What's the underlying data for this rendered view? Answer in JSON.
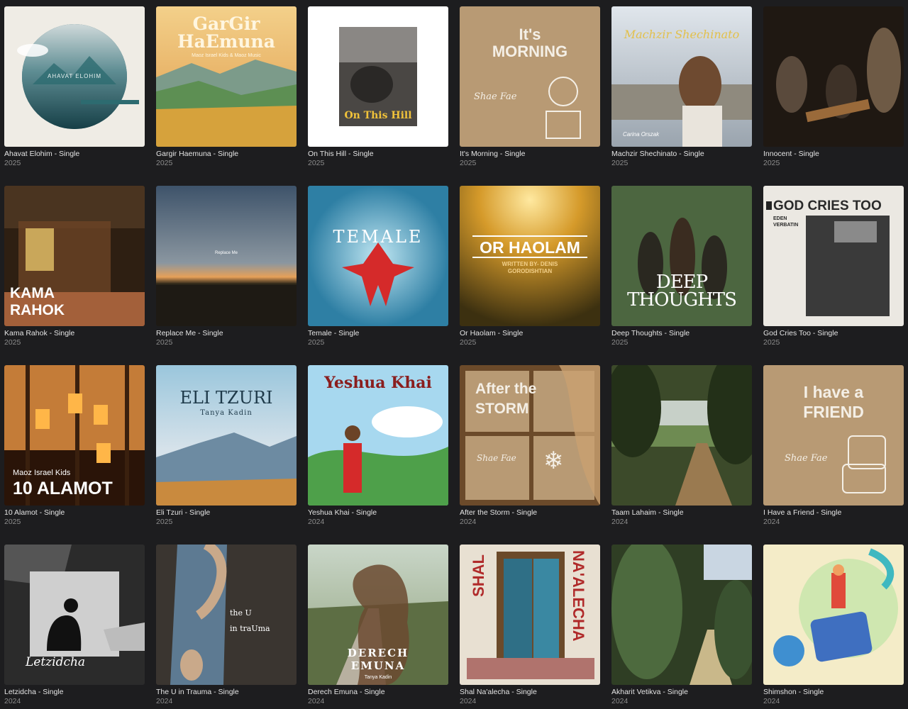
{
  "albums": [
    {
      "title": "Ahavat Elohim - Single",
      "year": "2025",
      "cover_text": "AHAVAT ELOHIM",
      "cover_sub": "",
      "colors": [
        "#f0ede6",
        "#2d6b70"
      ]
    },
    {
      "title": "Gargir Haemuna - Single",
      "year": "2025",
      "cover_text": "GarGir",
      "cover_text2": "HaEmuna",
      "cover_sub": "Maoz Israel Kids & Maoz Music",
      "colors": [
        "#f2c26a",
        "#5d8f53"
      ]
    },
    {
      "title": "On This Hill - Single",
      "year": "2025",
      "cover_text": "On This Hill",
      "cover_sub": "",
      "colors": [
        "#ffffff",
        "#3d3b38"
      ]
    },
    {
      "title": "It's Morning - Single",
      "year": "2025",
      "cover_text": "It's",
      "cover_text2": "MORNING",
      "cover_sub": "Shae Fae",
      "colors": [
        "#b89a74",
        "#f4efe6"
      ]
    },
    {
      "title": "Machzir Shechinato - Single",
      "year": "2025",
      "cover_text": "Machzir Shechinato",
      "cover_sub": "Carina Orszak",
      "colors": [
        "#c9d3de",
        "#e3c04a"
      ]
    },
    {
      "title": "Innocent - Single",
      "year": "2025",
      "cover_text": "",
      "cover_sub": "",
      "colors": [
        "#241d17",
        "#6e5a45"
      ]
    },
    {
      "title": "Kama Rahok - Single",
      "year": "2025",
      "cover_text": "KAMA",
      "cover_text2": "RAHOK",
      "cover_sub": "",
      "colors": [
        "#3b2818",
        "#a3603a"
      ]
    },
    {
      "title": "Replace Me - Single",
      "year": "2025",
      "cover_text": "Replace Me",
      "cover_sub": "",
      "colors": [
        "#45596e",
        "#e6a058"
      ]
    },
    {
      "title": "Temale - Single",
      "year": "2025",
      "cover_text": "TEMALE",
      "cover_sub": "",
      "colors": [
        "#3f8fb0",
        "#d52a2a"
      ]
    },
    {
      "title": "Or Haolam - Single",
      "year": "2025",
      "cover_text": "OR HAOLAM",
      "cover_sub": "WRITTEN BY- DENIS GORODISHTIAN",
      "colors": [
        "#d59a2a",
        "#3c3010"
      ]
    },
    {
      "title": "Deep Thoughts - Single",
      "year": "2025",
      "cover_text": "DEEP",
      "cover_text2": "THOUGHTS",
      "cover_sub": "",
      "colors": [
        "#4c6640",
        "#2a2820"
      ]
    },
    {
      "title": "God Cries Too - Single",
      "year": "2025",
      "cover_text": "GOD CRIES TOO",
      "cover_sub": "EDEN VERBATIN",
      "colors": [
        "#ebe8e2",
        "#2a2a2a"
      ]
    },
    {
      "title": "10 Alamot - Single",
      "year": "2025",
      "cover_text": "10 ALAMOT",
      "cover_sub": "Maoz Israel Kids",
      "colors": [
        "#c47c38",
        "#2a1408"
      ]
    },
    {
      "title": "Eli Tzuri - Single",
      "year": "2025",
      "cover_text": "ELI TZURI",
      "cover_sub": "Tanya Kadin",
      "colors": [
        "#9ac6dc",
        "#c98a3e"
      ]
    },
    {
      "title": "Yeshua Khai - Single",
      "year": "2024",
      "cover_text": "Yeshua Khai",
      "cover_sub": "",
      "colors": [
        "#a7d8ef",
        "#4ea04a"
      ]
    },
    {
      "title": "After the Storm - Single",
      "year": "2024",
      "cover_text": "After the",
      "cover_text2": "STORM",
      "cover_sub": "Shae Fae",
      "colors": [
        "#b89a74",
        "#6b4a2a"
      ]
    },
    {
      "title": "Taam Lahaim - Single",
      "year": "2024",
      "cover_text": "",
      "cover_sub": "",
      "colors": [
        "#6e8b52",
        "#9a7a50"
      ]
    },
    {
      "title": "I Have a Friend - Single",
      "year": "2024",
      "cover_text": "I have a",
      "cover_text2": "FRIEND",
      "cover_sub": "Shae Fae",
      "colors": [
        "#b89a74",
        "#f4efe6"
      ]
    },
    {
      "title": "Letzidcha - Single",
      "year": "2024",
      "cover_text": "Letzidcha",
      "cover_sub": "",
      "colors": [
        "#2b2b2b",
        "#cfcfcf"
      ]
    },
    {
      "title": "The U in Trauma - Single",
      "year": "2024",
      "cover_text": "the U",
      "cover_text2": "in traUma",
      "cover_sub": "",
      "colors": [
        "#3a3530",
        "#5d7a92"
      ]
    },
    {
      "title": "Derech Emuna - Single",
      "year": "2024",
      "cover_text": "DERECH",
      "cover_text2": "EMUNA",
      "cover_sub": "Tanya Kadin",
      "colors": [
        "#8fa07a",
        "#6b4a30"
      ]
    },
    {
      "title": "Shal Na'alecha - Single",
      "year": "2024",
      "cover_text": "SHAL",
      "cover_text2": "NA'ALECHA",
      "cover_sub": "",
      "colors": [
        "#e8e0d2",
        "#2f6f86"
      ]
    },
    {
      "title": "Akharit Vetikva - Single",
      "year": "2024",
      "cover_text": "",
      "cover_sub": "",
      "colors": [
        "#4d6a3e",
        "#c9b88a"
      ]
    },
    {
      "title": "Shimshon - Single",
      "year": "2024",
      "cover_text": "",
      "cover_sub": "",
      "colors": [
        "#f4ecc8",
        "#3f8fd0"
      ]
    }
  ]
}
